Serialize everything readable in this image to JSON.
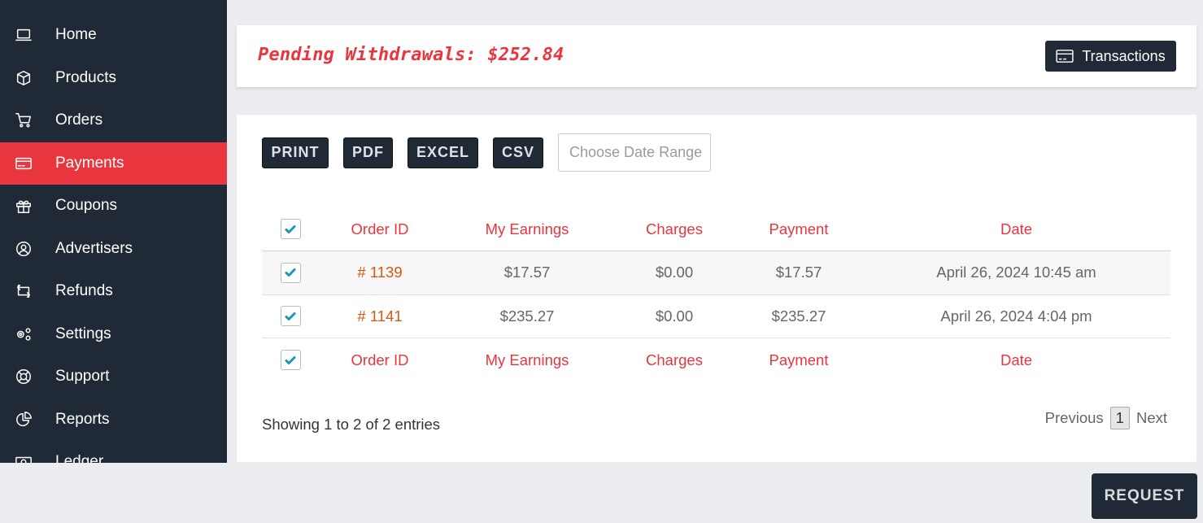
{
  "sidebar": {
    "items": [
      {
        "label": "Home",
        "icon": "laptop-icon"
      },
      {
        "label": "Products",
        "icon": "box-icon"
      },
      {
        "label": "Orders",
        "icon": "cart-icon"
      },
      {
        "label": "Payments",
        "icon": "credit-card-icon",
        "active": true
      },
      {
        "label": "Coupons",
        "icon": "gift-icon"
      },
      {
        "label": "Advertisers",
        "icon": "user-circle-icon"
      },
      {
        "label": "Refunds",
        "icon": "repeat-icon"
      },
      {
        "label": "Settings",
        "icon": "gears-icon"
      },
      {
        "label": "Support",
        "icon": "lifebuoy-icon"
      },
      {
        "label": "Reports",
        "icon": "pie-chart-icon"
      },
      {
        "label": "Ledger",
        "icon": "cash-icon"
      }
    ]
  },
  "header": {
    "pending_text": "Pending Withdrawals: $252.84",
    "transactions_label": "Transactions"
  },
  "toolbar": {
    "print": "PRINT",
    "pdf": "PDF",
    "excel": "EXCEL",
    "csv": "CSV",
    "date_placeholder": "Choose Date Range"
  },
  "table": {
    "columns": [
      "Order ID",
      "My Earnings",
      "Charges",
      "Payment",
      "Date"
    ],
    "rows": [
      {
        "order_id": "# 1139",
        "earnings": "$17.57",
        "charges": "$0.00",
        "payment": "$17.57",
        "date": "April 26, 2024 10:45 am"
      },
      {
        "order_id": "# 1141",
        "earnings": "$235.27",
        "charges": "$0.00",
        "payment": "$235.27",
        "date": "April 26, 2024 4:04 pm"
      }
    ]
  },
  "footer": {
    "info": "Showing 1 to 2 of 2 entries",
    "previous": "Previous",
    "page": "1",
    "next": "Next"
  },
  "request_label": "REQUEST",
  "colors": {
    "sidebar_bg": "#1f2a36",
    "accent_red": "#e8353e",
    "order_link": "#d35a0f",
    "checkbox_check": "#1a98b8"
  }
}
